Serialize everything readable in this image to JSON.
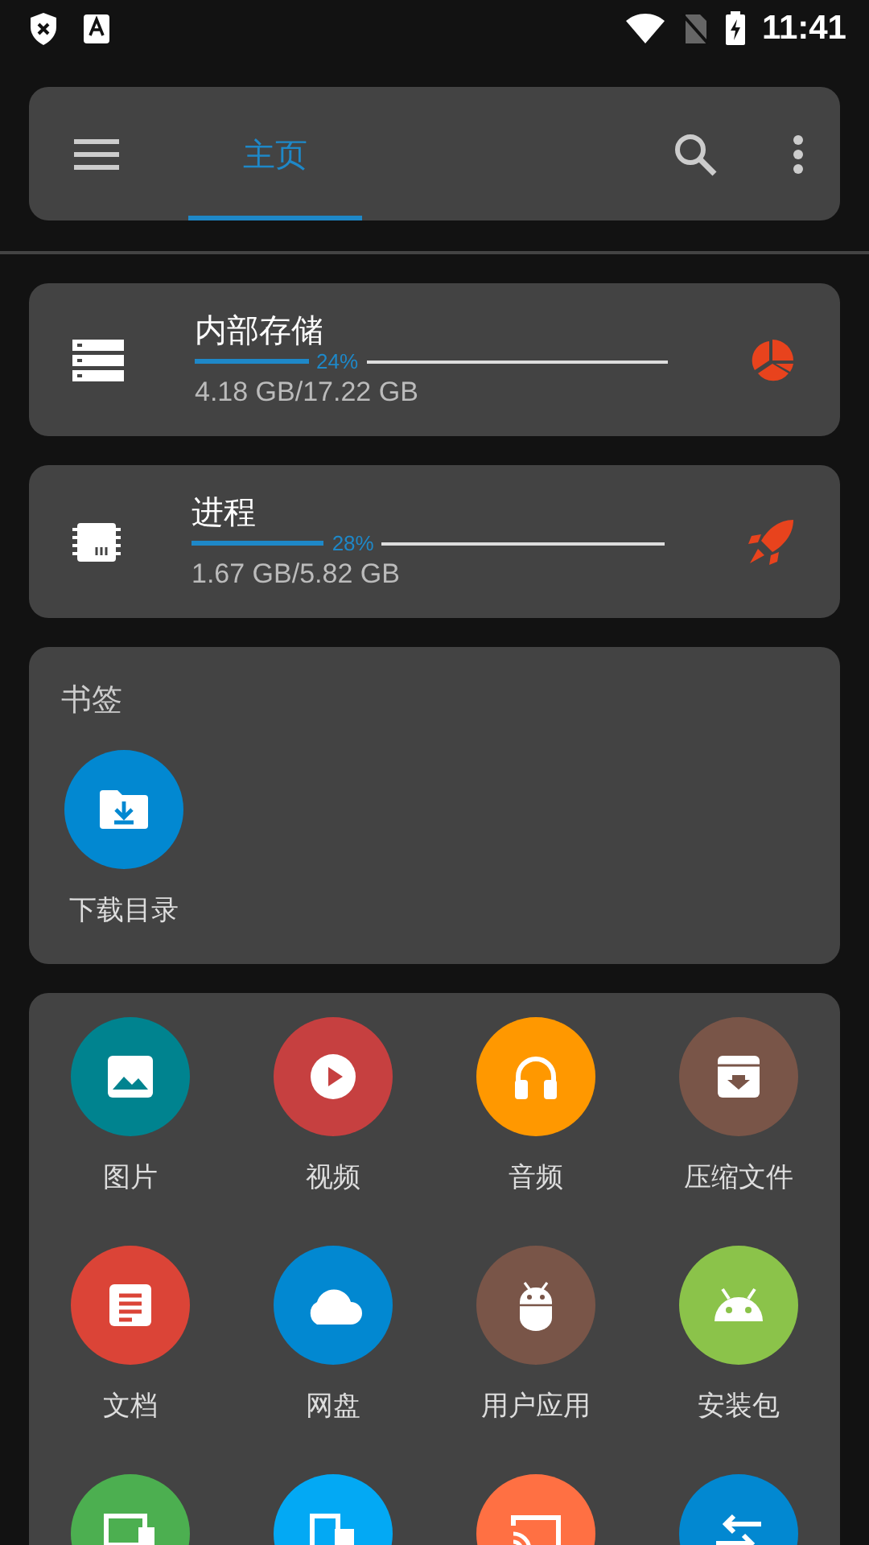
{
  "status_bar": {
    "time": "11:41"
  },
  "toolbar": {
    "tabs": [
      {
        "label": "主页",
        "selected": true
      }
    ]
  },
  "storage_cards": [
    {
      "kind": "storage",
      "title": "内部存储",
      "level": 0.24,
      "percent": "24%",
      "usage": "4.18 GB/17.22 GB"
    },
    {
      "kind": "memory",
      "title": "进程",
      "level": 0.28,
      "percent": "28%",
      "usage": "1.67 GB/5.82 GB"
    }
  ],
  "bookmarks": {
    "title": "书签",
    "items": [
      {
        "label": "下载目录",
        "color": "#0288d1"
      }
    ]
  },
  "categories": [
    {
      "kind": "image",
      "label": "图片",
      "color": "#00838f"
    },
    {
      "kind": "video",
      "label": "视频",
      "color": "#c64040"
    },
    {
      "kind": "audio",
      "label": "音频",
      "color": "#ff9800"
    },
    {
      "kind": "archive",
      "label": "压缩文件",
      "color": "#795548"
    },
    {
      "kind": "document",
      "label": "文档",
      "color": "#db4437"
    },
    {
      "kind": "cloud",
      "label": "网盘",
      "color": "#0288d1"
    },
    {
      "kind": "app",
      "label": "用户应用",
      "color": "#795548"
    },
    {
      "kind": "apk",
      "label": "安装包",
      "color": "#8bc34a"
    },
    {
      "kind": "devices",
      "color": "#4caf50"
    },
    {
      "kind": "phone",
      "color": "#03a9f4"
    },
    {
      "kind": "cast",
      "color": "#ff7043"
    },
    {
      "kind": "transfer",
      "color": "#0288d1"
    }
  ]
}
